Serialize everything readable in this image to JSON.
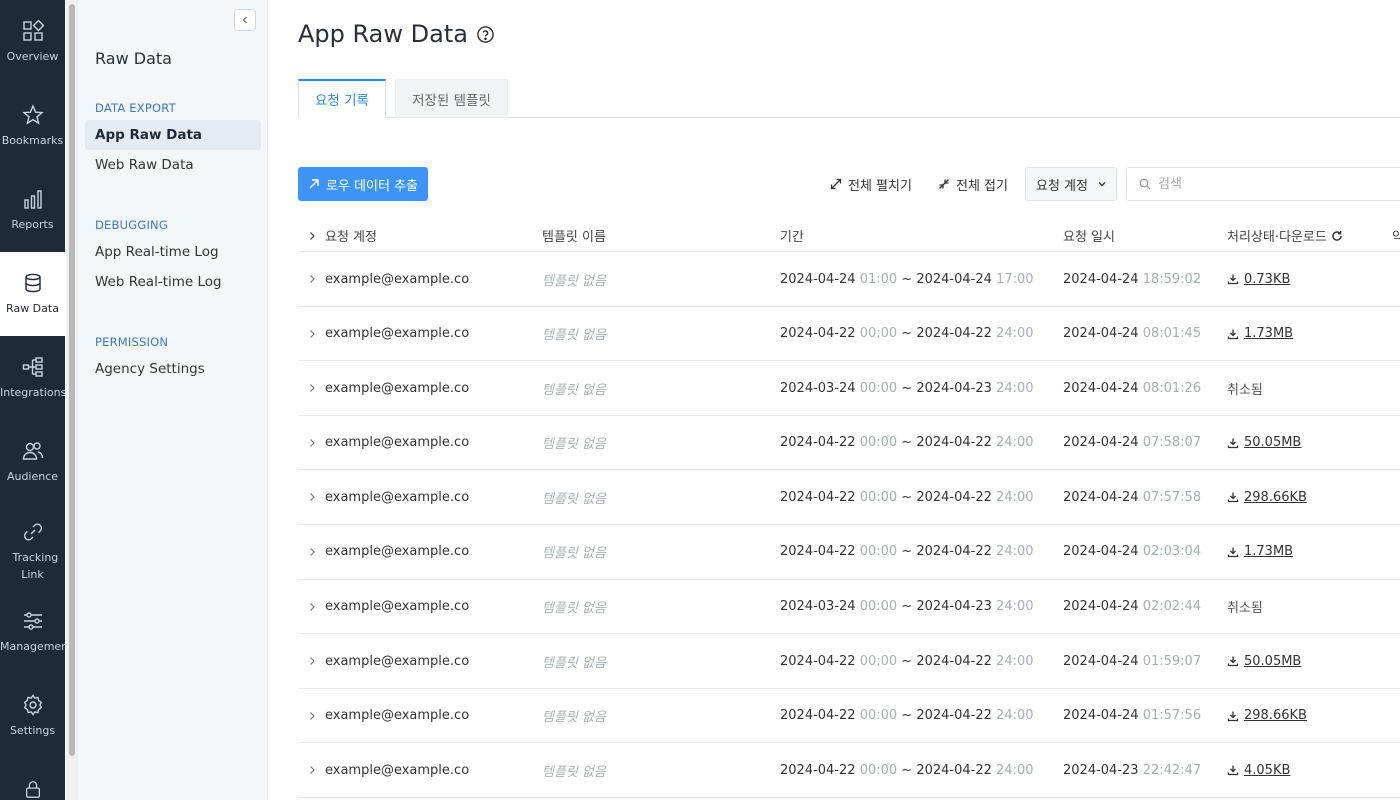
{
  "rail": {
    "items": [
      {
        "label": "Overview",
        "icon": "overview-icon"
      },
      {
        "label": "Bookmarks",
        "icon": "star-icon"
      },
      {
        "label": "Reports",
        "icon": "bar-chart-icon"
      },
      {
        "label": "Raw Data",
        "icon": "database-icon"
      },
      {
        "label": "Integrations",
        "icon": "integrations-icon"
      },
      {
        "label": "Audience",
        "icon": "users-icon"
      },
      {
        "label": "Tracking Link",
        "icon": "link-icon"
      },
      {
        "label": "Management",
        "icon": "sliders-icon"
      },
      {
        "label": "Settings",
        "icon": "gear-icon"
      }
    ]
  },
  "subnav": {
    "title": "Raw Data",
    "sections": [
      {
        "heading": "DATA EXPORT",
        "links": [
          "App Raw Data",
          "Web Raw Data"
        ]
      },
      {
        "heading": "DEBUGGING",
        "links": [
          "App Real-time Log",
          "Web Real-time Log"
        ]
      },
      {
        "heading": "PERMISSION",
        "links": [
          "Agency Settings"
        ]
      }
    ]
  },
  "main": {
    "title": "App Raw Data",
    "tabs": [
      "요청 기록",
      "저장된 템플릿"
    ],
    "toolbar": {
      "extract_label": "로우 데이터 추출",
      "expand_all": "전체 펼치기",
      "collapse_all": "전체 접기",
      "account_select": "요청 계정",
      "search_placeholder": "검색"
    },
    "table": {
      "headers": [
        "요청 계정",
        "템플릿 이름",
        "기간",
        "요청 일시",
        "처리상태·다운로드",
        "약"
      ],
      "rows": [
        {
          "account": "example@example.co",
          "template": "템플릿 없음",
          "start_date": "2024-04-24",
          "start_time": "01:00",
          "end_date": "2024-04-24",
          "end_time": "17:00",
          "req_date": "2024-04-24",
          "req_time": "18:59:02",
          "status": "0.73KB",
          "is_file": true
        },
        {
          "account": "example@example.co",
          "template": "템플릿 없음",
          "start_date": "2024-04-22",
          "start_time": "00:00",
          "end_date": "2024-04-22",
          "end_time": "24:00",
          "req_date": "2024-04-24",
          "req_time": "08:01:45",
          "status": "1.73MB",
          "is_file": true
        },
        {
          "account": "example@example.co",
          "template": "템플릿 없음",
          "start_date": "2024-03-24",
          "start_time": "00:00",
          "end_date": "2024-04-23",
          "end_time": "24:00",
          "req_date": "2024-04-24",
          "req_time": "08:01:26",
          "status": "취소됨",
          "is_file": false
        },
        {
          "account": "example@example.co",
          "template": "템플릿 없음",
          "start_date": "2024-04-22",
          "start_time": "00:00",
          "end_date": "2024-04-22",
          "end_time": "24:00",
          "req_date": "2024-04-24",
          "req_time": "07:58:07",
          "status": "50.05MB",
          "is_file": true
        },
        {
          "account": "example@example.co",
          "template": "템플릿 없음",
          "start_date": "2024-04-22",
          "start_time": "00:00",
          "end_date": "2024-04-22",
          "end_time": "24:00",
          "req_date": "2024-04-24",
          "req_time": "07:57:58",
          "status": "298.66KB",
          "is_file": true
        },
        {
          "account": "example@example.co",
          "template": "템플릿 없음",
          "start_date": "2024-04-22",
          "start_time": "00:00",
          "end_date": "2024-04-22",
          "end_time": "24:00",
          "req_date": "2024-04-24",
          "req_time": "02:03:04",
          "status": "1.73MB",
          "is_file": true
        },
        {
          "account": "example@example.co",
          "template": "템플릿 없음",
          "start_date": "2024-03-24",
          "start_time": "00:00",
          "end_date": "2024-04-23",
          "end_time": "24:00",
          "req_date": "2024-04-24",
          "req_time": "02:02:44",
          "status": "취소됨",
          "is_file": false
        },
        {
          "account": "example@example.co",
          "template": "템플릿 없음",
          "start_date": "2024-04-22",
          "start_time": "00:00",
          "end_date": "2024-04-22",
          "end_time": "24:00",
          "req_date": "2024-04-24",
          "req_time": "01:59:07",
          "status": "50.05MB",
          "is_file": true
        },
        {
          "account": "example@example.co",
          "template": "템플릿 없음",
          "start_date": "2024-04-22",
          "start_time": "00:00",
          "end_date": "2024-04-22",
          "end_time": "24:00",
          "req_date": "2024-04-24",
          "req_time": "01:57:56",
          "status": "298.66KB",
          "is_file": true
        },
        {
          "account": "example@example.co",
          "template": "템플릿 없음",
          "start_date": "2024-04-22",
          "start_time": "00:00",
          "end_date": "2024-04-22",
          "end_time": "24:00",
          "req_date": "2024-04-23",
          "req_time": "22:42:47",
          "status": "4.05KB",
          "is_file": true
        }
      ]
    }
  },
  "colors": {
    "rail_bg": "#1e2a38",
    "accent": "#3d94f5",
    "section_heading": "#3a78c2"
  }
}
